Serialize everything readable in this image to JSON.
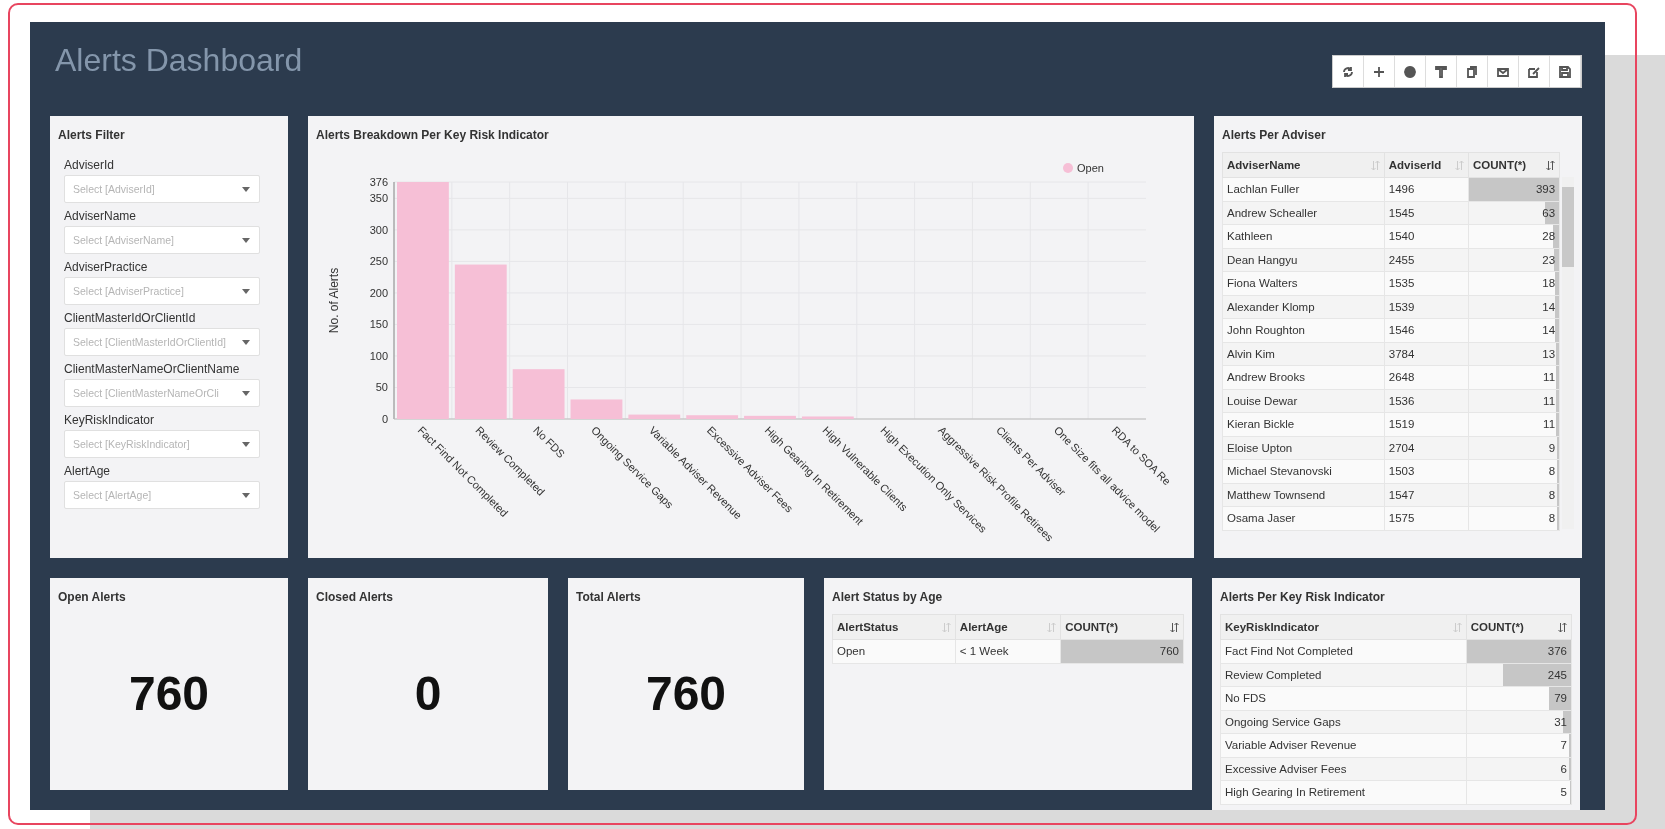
{
  "header": {
    "title": "Alerts Dashboard",
    "toolbar": [
      {
        "kind": "refresh"
      },
      {
        "kind": "add"
      },
      {
        "kind": "info"
      },
      {
        "kind": "filter"
      },
      {
        "kind": "copy"
      },
      {
        "kind": "email"
      },
      {
        "kind": "edit"
      },
      {
        "kind": "save"
      }
    ]
  },
  "filter_panel": {
    "title": "Alerts Filter",
    "filters": [
      {
        "label": "AdviserId",
        "placeholder": "Select [AdviserId]"
      },
      {
        "label": "AdviserName",
        "placeholder": "Select [AdviserName]"
      },
      {
        "label": "AdviserPractice",
        "placeholder": "Select [AdviserPractice]"
      },
      {
        "label": "ClientMasterIdOrClientId",
        "placeholder": "Select [ClientMasterIdOrClientId]"
      },
      {
        "label": "ClientMasterNameOrClientName",
        "placeholder": "Select [ClientMasterNameOrCli"
      },
      {
        "label": "KeyRiskIndicator",
        "placeholder": "Select [KeyRiskIndicator]"
      },
      {
        "label": "AlertAge",
        "placeholder": "Select [AlertAge]"
      }
    ]
  },
  "chart_panel": {
    "title": "Alerts Breakdown Per Key Risk Indicator",
    "chart_data": {
      "type": "bar",
      "ylabel": "No. of Alerts",
      "categories": [
        "Fact Find Not Completed",
        "Review Completed",
        "No FDS",
        "Ongoing Service Gaps",
        "Variable Adviser Revenue",
        "Excessive Adviser Fees",
        "High Gearing In Retirement",
        "High Vulnerable Clients",
        "High Execution Only Services",
        "Aggressive Risk Profile Retirees",
        "Clients Per Adviser",
        "One Size fits all advice model",
        "RDA to SOA Re"
      ],
      "series": [
        {
          "name": "Open",
          "color": "#f6bfd6",
          "values": [
            376,
            245,
            79,
            31,
            7,
            6,
            5,
            4,
            null,
            null,
            null,
            null,
            null
          ]
        }
      ],
      "grid": true,
      "ylim": [
        0,
        376
      ],
      "yticks": [
        0,
        50,
        100,
        150,
        200,
        250,
        300,
        350,
        376
      ]
    }
  },
  "adviser_panel": {
    "title": "Alerts Per Adviser",
    "columns": [
      {
        "label": "AdviserName",
        "sorted": false
      },
      {
        "label": "AdviserId",
        "sorted": false
      },
      {
        "label": "COUNT(*)",
        "sorted": true
      }
    ],
    "rows": [
      {
        "name": "Lachlan Fuller",
        "id": "1496",
        "count": "393",
        "level": 1
      },
      {
        "name": "Andrew Schealler",
        "id": "1545",
        "count": "63",
        "level": 0.16
      },
      {
        "name": "Kathleen",
        "id": "1540",
        "count": "28",
        "level": 0.07
      },
      {
        "name": "Dean Hangyu",
        "id": "2455",
        "count": "23",
        "level": 0.06
      },
      {
        "name": "Fiona Walters",
        "id": "1535",
        "count": "18",
        "level": 0.05
      },
      {
        "name": "Alexander Klomp",
        "id": "1539",
        "count": "14",
        "level": 0.04
      },
      {
        "name": "John Roughton",
        "id": "1546",
        "count": "14",
        "level": 0.04
      },
      {
        "name": "Alvin Kim",
        "id": "3784",
        "count": "13",
        "level": 0.03
      },
      {
        "name": "Andrew Brooks",
        "id": "2648",
        "count": "11",
        "level": 0.03
      },
      {
        "name": "Louise Dewar",
        "id": "1536",
        "count": "11",
        "level": 0.03
      },
      {
        "name": "Kieran Bickle",
        "id": "1519",
        "count": "11",
        "level": 0.03
      },
      {
        "name": "Eloise Upton",
        "id": "2704",
        "count": "9",
        "level": 0.02
      },
      {
        "name": "Michael Stevanovski",
        "id": "1503",
        "count": "8",
        "level": 0.02
      },
      {
        "name": "Matthew Townsend",
        "id": "1547",
        "count": "8",
        "level": 0.02
      },
      {
        "name": "Osama Jaser",
        "id": "1575",
        "count": "8",
        "level": 0.02
      }
    ]
  },
  "stat_cards": [
    {
      "title": "Open Alerts",
      "value": "760"
    },
    {
      "title": "Closed Alerts",
      "value": "0"
    },
    {
      "title": "Total Alerts",
      "value": "760"
    }
  ],
  "status_panel": {
    "title": "Alert Status by Age",
    "columns": [
      {
        "label": "AlertStatus",
        "sorted": false
      },
      {
        "label": "AlertAge",
        "sorted": false
      },
      {
        "label": "COUNT(*)",
        "sorted": true
      }
    ],
    "rows": [
      {
        "status": "Open",
        "age": "< 1 Week",
        "count": "760",
        "level": 1
      }
    ]
  },
  "kri_panel": {
    "title": "Alerts Per Key Risk Indicator",
    "columns": [
      {
        "label": "KeyRiskIndicator",
        "sorted": false
      },
      {
        "label": "COUNT(*)",
        "sorted": true
      }
    ],
    "rows": [
      {
        "name": "Fact Find Not Completed",
        "count": "376",
        "level": 1
      },
      {
        "name": "Review Completed",
        "count": "245",
        "level": 0.65
      },
      {
        "name": "No FDS",
        "count": "79",
        "level": 0.21
      },
      {
        "name": "Ongoing Service Gaps",
        "count": "31",
        "level": 0.08
      },
      {
        "name": "Variable Adviser Revenue",
        "count": "7",
        "level": 0.02
      },
      {
        "name": "Excessive Adviser Fees",
        "count": "6",
        "level": 0.02
      },
      {
        "name": "High Gearing In Retirement",
        "count": "5",
        "level": 0.01
      }
    ]
  }
}
